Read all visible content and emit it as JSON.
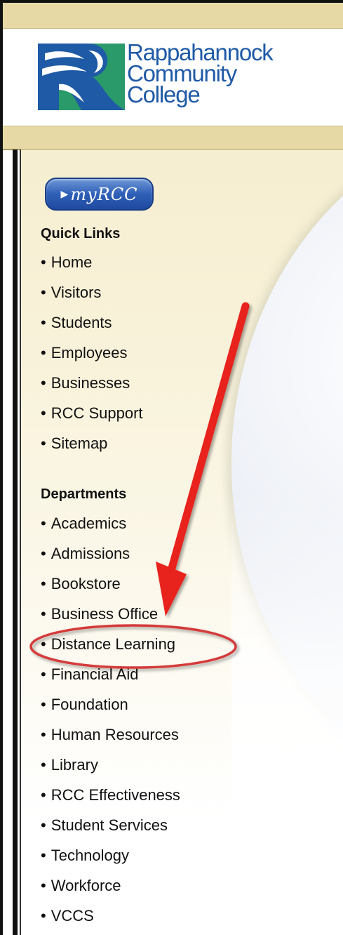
{
  "header": {
    "logo_lines": [
      "Rappahannock",
      "Community",
      "College"
    ]
  },
  "myrcc": {
    "label": "myRCC",
    "icon": "play-triangle-icon"
  },
  "quick_links": {
    "heading": "Quick Links",
    "items": [
      "Home",
      "Visitors",
      "Students",
      "Employees",
      "Businesses",
      "RCC Support",
      "Sitemap"
    ]
  },
  "departments": {
    "heading": "Departments",
    "items": [
      "Academics",
      "Admissions",
      "Bookstore",
      "Business Office",
      "Distance Learning",
      "Financial Aid",
      "Foundation",
      "Human Resources",
      "Library",
      "RCC Effectiveness",
      "Student Services",
      "Technology",
      "Workforce",
      "VCCS"
    ]
  },
  "annotation": {
    "highlighted_item": "Distance Learning",
    "arrow_color": "#e8201a",
    "circle_color": "#d43a3a"
  },
  "colors": {
    "brand_blue": "#1f5aa6",
    "brand_green": "#2a9a6a",
    "band": "#e6d9a6"
  }
}
